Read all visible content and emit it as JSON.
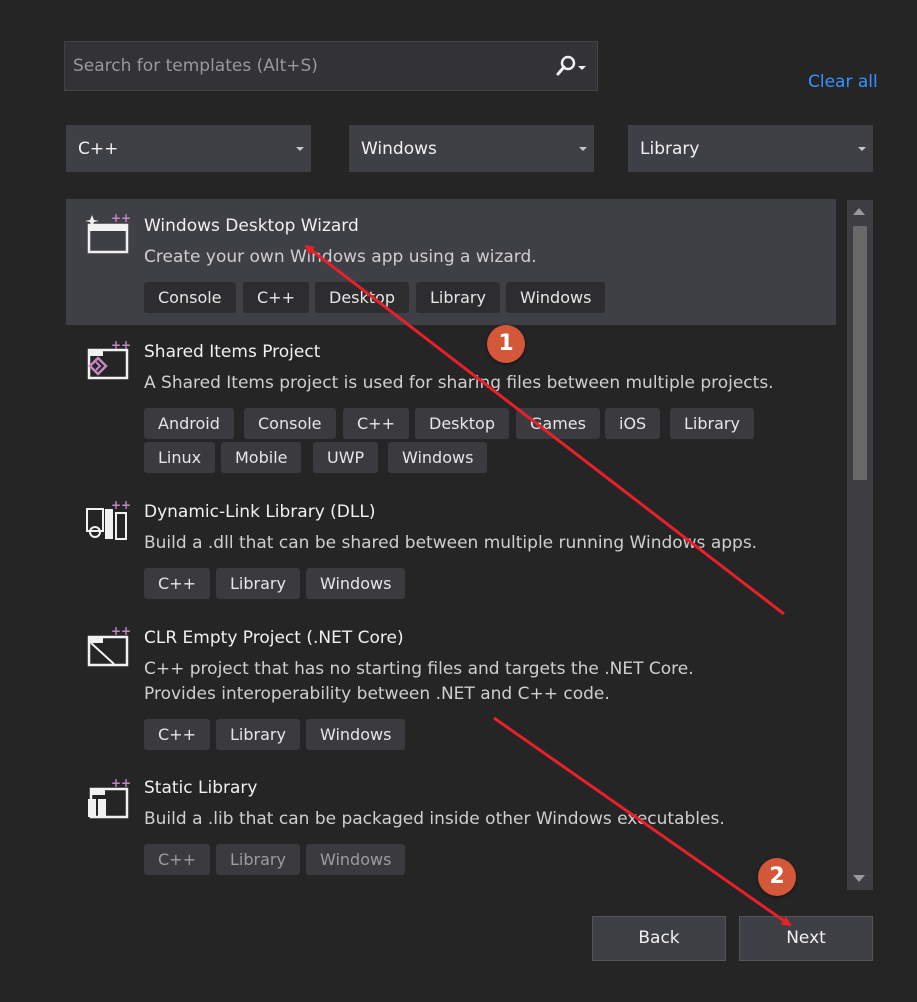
{
  "search": {
    "placeholder": "Search for templates (Alt+S)",
    "value": ""
  },
  "clear_all": "Clear all",
  "filters": {
    "language": "C++",
    "platform": "Windows",
    "project_type": "Library"
  },
  "templates": [
    {
      "title": "Windows Desktop Wizard",
      "description": "Create your own Windows app using a wizard.",
      "tags": [
        "Console",
        "C++",
        "Desktop",
        "Library",
        "Windows"
      ]
    },
    {
      "title": "Shared Items Project",
      "description": "A Shared Items project is used for sharing files between multiple projects.",
      "tags": [
        "Android",
        "Console",
        "C++",
        "Desktop",
        "Games",
        "iOS",
        "Library",
        "Linux",
        "Mobile",
        "UWP",
        "Windows"
      ]
    },
    {
      "title": "Dynamic-Link Library (DLL)",
      "description": "Build a .dll that can be shared between multiple running Windows apps.",
      "tags": [
        "C++",
        "Library",
        "Windows"
      ]
    },
    {
      "title": "CLR Empty Project (.NET Core)",
      "description": "C++ project that has no starting files and targets the .NET Core. Provides interoperability between .NET and C++ code.",
      "tags": [
        "C++",
        "Library",
        "Windows"
      ]
    },
    {
      "title": "Static Library",
      "description": "Build a .lib that can be packaged inside other Windows executables.",
      "tags": [
        "C++",
        "Library",
        "Windows"
      ]
    }
  ],
  "buttons": {
    "back": "Back",
    "next": "Next"
  },
  "annotations": {
    "step1": "1",
    "step2": "2"
  },
  "colors": {
    "background": "#252526",
    "selected": "#3f3f46",
    "link": "#3794ff",
    "badge": "#d4573a",
    "arrow": "#e8202a",
    "icon_accent": "#c586c0"
  },
  "icons": {
    "search": "search-icon",
    "dropdown": "chevron-down-icon"
  }
}
